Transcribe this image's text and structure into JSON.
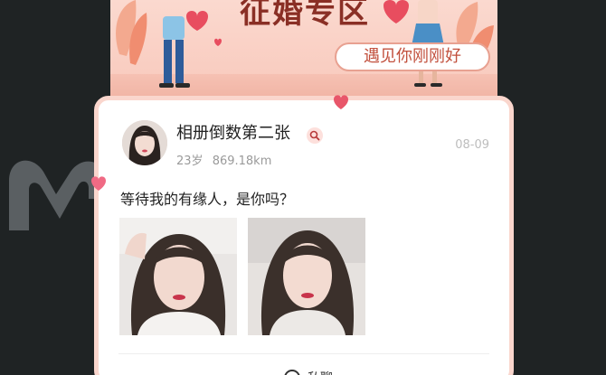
{
  "banner": {
    "title": "征婚专区",
    "subtitle": "遇见你刚刚好"
  },
  "post": {
    "username": "相册倒数第二张",
    "age": "23岁",
    "distance": "869.18km",
    "date": "08-09",
    "text": "等待我的有缘人，是你吗？"
  },
  "actions": {
    "chat_label": "私聊"
  },
  "icons": {
    "search": "search-icon",
    "chat": "chat-icon",
    "heart": "heart-icon"
  },
  "colors": {
    "background": "#1f2324",
    "banner": "#f8c8bb",
    "title": "#8a2f25",
    "accent": "#e8566a"
  }
}
